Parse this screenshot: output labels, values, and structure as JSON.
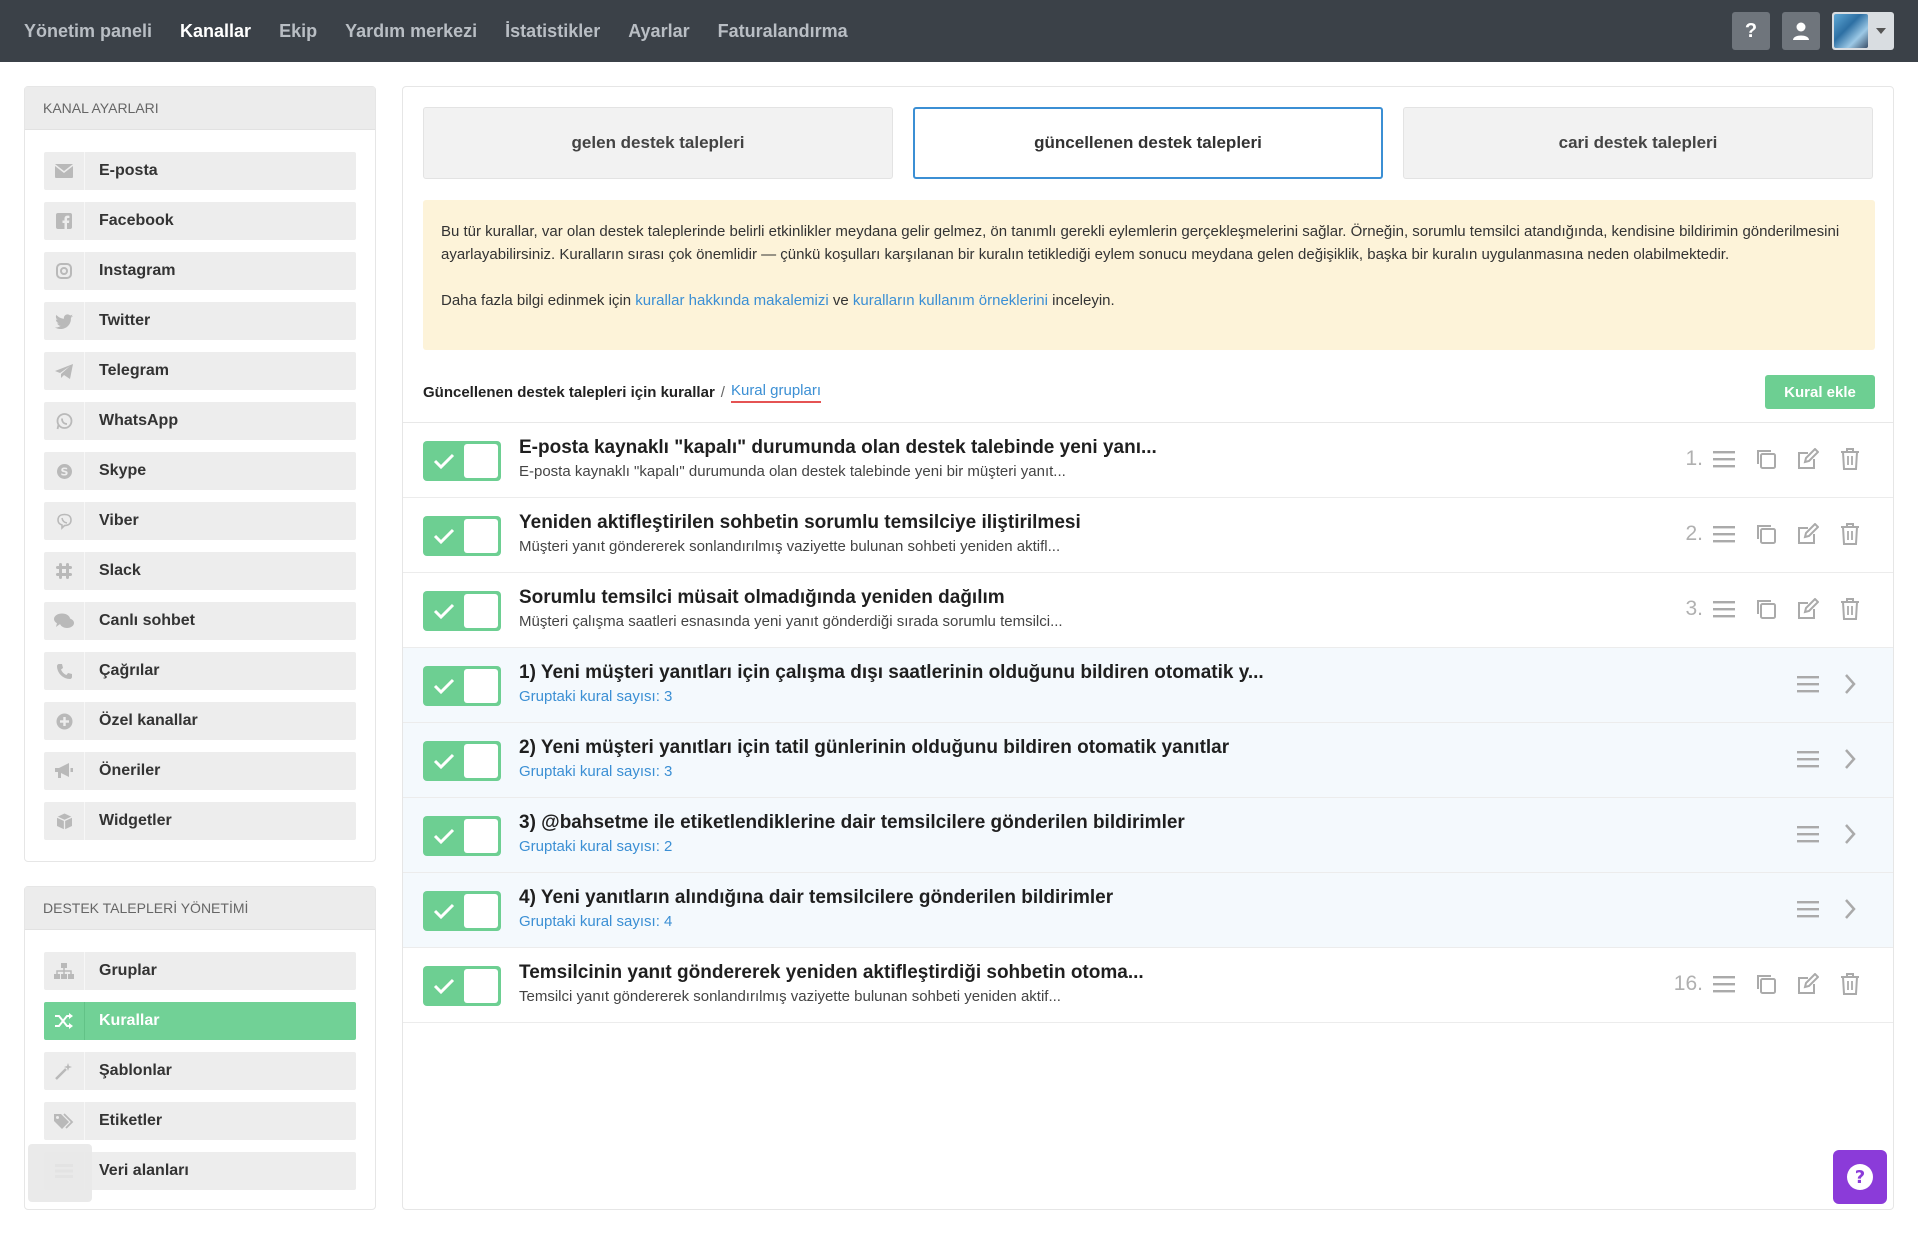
{
  "topnav": {
    "items": [
      {
        "label": "Yönetim paneli",
        "active": false
      },
      {
        "label": "Kanallar",
        "active": true
      },
      {
        "label": "Ekip",
        "active": false
      },
      {
        "label": "Yardım merkezi",
        "active": false
      },
      {
        "label": "İstatistikler",
        "active": false
      },
      {
        "label": "Ayarlar",
        "active": false
      },
      {
        "label": "Faturalandırma",
        "active": false
      }
    ],
    "help_label": "?"
  },
  "sidebar": {
    "channels": {
      "heading": "KANAL AYARLARI",
      "items": [
        {
          "label": "E-posta",
          "icon": "envelope-icon"
        },
        {
          "label": "Facebook",
          "icon": "facebook-icon"
        },
        {
          "label": "Instagram",
          "icon": "instagram-icon"
        },
        {
          "label": "Twitter",
          "icon": "twitter-icon"
        },
        {
          "label": "Telegram",
          "icon": "telegram-icon"
        },
        {
          "label": "WhatsApp",
          "icon": "whatsapp-icon"
        },
        {
          "label": "Skype",
          "icon": "skype-icon"
        },
        {
          "label": "Viber",
          "icon": "viber-icon"
        },
        {
          "label": "Slack",
          "icon": "slack-icon"
        },
        {
          "label": "Canlı sohbet",
          "icon": "chat-icon"
        },
        {
          "label": "Çağrılar",
          "icon": "phone-icon"
        },
        {
          "label": "Özel kanallar",
          "icon": "plus-circle-icon"
        },
        {
          "label": "Öneriler",
          "icon": "megaphone-icon"
        },
        {
          "label": "Widgetler",
          "icon": "cube-icon"
        }
      ]
    },
    "tickets": {
      "heading": "DESTEK TALEPLERİ YÖNETİMİ",
      "items": [
        {
          "label": "Gruplar",
          "icon": "sitemap-icon",
          "active": false
        },
        {
          "label": "Kurallar",
          "icon": "shuffle-icon",
          "active": true
        },
        {
          "label": "Şablonlar",
          "icon": "magic-wand-icon",
          "active": false
        },
        {
          "label": "Etiketler",
          "icon": "tags-icon",
          "active": false
        },
        {
          "label": "Veri alanları",
          "icon": "fields-icon",
          "active": false
        }
      ]
    }
  },
  "main": {
    "tabs": [
      {
        "label": "gelen destek talepleri",
        "active": false
      },
      {
        "label": "güncellenen destek talepleri",
        "active": true
      },
      {
        "label": "cari destek talepleri",
        "active": false
      }
    ],
    "notice": {
      "text": "Bu tür kurallar, var olan destek taleplerinde belirli etkinlikler meydana gelir gelmez, ön tanımlı gerekli eylemlerin gerçekleşmelerini sağlar. Örneğin, sorumlu temsilci atandığında, kendisine bildirimin gönderilmesini ayarlayabilirsiniz. Kuralların sırası çok önemlidir — çünkü koşulları karşılanan bir kuralın tetiklediği eylem sonucu meydana gelen değişiklik, başka bir kuralın uygulanmasına neden olabilmektedir.",
      "more_prefix": "Daha fazla bilgi edinmek için",
      "link1": "kurallar hakkında makalemizi",
      "and": "ve",
      "link2": "kuralların kullanım örneklerini",
      "suffix": "inceleyin."
    },
    "rules_header": {
      "title": "Güncellenen destek talepleri için kurallar",
      "separator": "/",
      "groups_link": "Kural grupları",
      "add_button": "Kural ekle"
    },
    "rules": [
      {
        "type": "rule",
        "title": "E-posta kaynaklı \"kapalı\" durumunda olan destek talebinde yeni yanı...",
        "subtitle": "E-posta kaynaklı \"kapalı\" durumunda olan destek talebinde yeni bir müşteri yanıt...",
        "num": "1.",
        "enabled": true
      },
      {
        "type": "rule",
        "title": "Yeniden aktifleştirilen sohbetin sorumlu temsilciye iliştirilmesi",
        "subtitle": "Müşteri yanıt göndererek sonlandırılmış vaziyette bulunan sohbeti yeniden aktifl...",
        "num": "2.",
        "enabled": true
      },
      {
        "type": "rule",
        "title": "Sorumlu temsilci müsait olmadığında yeniden dağılım",
        "subtitle": "Müşteri çalışma saatleri esnasında yeni yanıt gönderdiği sırada sorumlu temsilci...",
        "num": "3.",
        "enabled": true
      },
      {
        "type": "group",
        "title": "1) Yeni müşteri yanıtları için çalışma dışı saatlerinin olduğunu bildiren otomatik y...",
        "subtitle": "Gruptaki kural sayısı: 3",
        "enabled": true
      },
      {
        "type": "group",
        "title": "2) Yeni müşteri yanıtları için tatil günlerinin olduğunu bildiren otomatik yanıtlar",
        "subtitle": "Gruptaki kural sayısı: 3",
        "enabled": true
      },
      {
        "type": "group",
        "title": "3) @bahsetme ile etiketlendiklerine dair temsilcilere gönderilen bildirimler",
        "subtitle": "Gruptaki kural sayısı: 2",
        "enabled": true
      },
      {
        "type": "group",
        "title": "4) Yeni yanıtların alındığına dair temsilcilere gönderilen bildirimler",
        "subtitle": "Gruptaki kural sayısı: 4",
        "enabled": true
      },
      {
        "type": "rule",
        "title": "Temsilcinin yanıt göndererek yeniden aktifleştirdiği sohbetin otoma...",
        "subtitle": "Temsilci yanıt göndererek sonlandırılmış vaziyette bulunan sohbeti yeniden aktif...",
        "num": "16.",
        "enabled": true
      }
    ]
  },
  "colors": {
    "topbar": "#3b4148",
    "accent_green": "#6dcf92",
    "link_blue": "#3b8fd4",
    "notice_bg": "#fdf3d9",
    "help_purple": "#8b3bd9"
  }
}
